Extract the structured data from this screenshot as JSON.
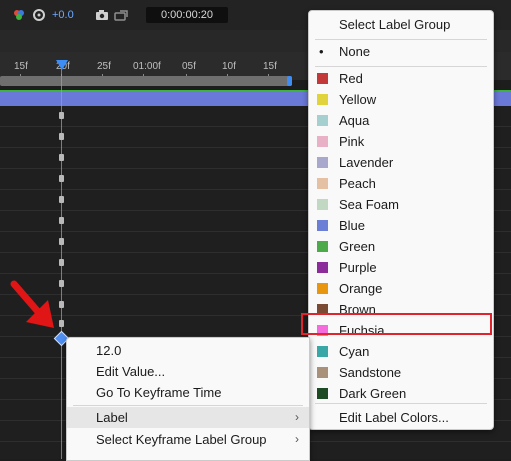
{
  "toolbar": {
    "zoom_value": "+0.0",
    "timecode": "0:00:00:20"
  },
  "ruler": {
    "ticks": [
      "15f",
      "20f",
      "25f",
      "01:00f",
      "05f",
      "10f",
      "15f"
    ]
  },
  "label_menu": {
    "title": "Select Label Group",
    "none_bullet": "•",
    "none_label": "None",
    "items": [
      {
        "label": "Red",
        "color": "#c3393a"
      },
      {
        "label": "Yellow",
        "color": "#e0d33c"
      },
      {
        "label": "Aqua",
        "color": "#a6cfcf"
      },
      {
        "label": "Pink",
        "color": "#e9b1c5"
      },
      {
        "label": "Lavender",
        "color": "#a8a8cc"
      },
      {
        "label": "Peach",
        "color": "#e5c0a3"
      },
      {
        "label": "Sea Foam",
        "color": "#c1d8c2"
      },
      {
        "label": "Blue",
        "color": "#6c7fd6"
      },
      {
        "label": "Green",
        "color": "#4caa4a"
      },
      {
        "label": "Purple",
        "color": "#8c2b9a"
      },
      {
        "label": "Orange",
        "color": "#e8960f"
      },
      {
        "label": "Brown",
        "color": "#7b4a35"
      },
      {
        "label": "Fuchsia",
        "color": "#f36bdc"
      },
      {
        "label": "Cyan",
        "color": "#3aa7a7"
      },
      {
        "label": "Sandstone",
        "color": "#a8907a"
      },
      {
        "label": "Dark Green",
        "color": "#1c4b24"
      }
    ],
    "edit_colors": "Edit Label Colors...",
    "highlighted": "Fuchsia"
  },
  "context_menu": {
    "value": "12.0",
    "edit_value": "Edit Value...",
    "go_to_keyframe": "Go To Keyframe Time",
    "label": "Label",
    "select_group": "Select Keyframe Label Group",
    "chevron": "›"
  }
}
